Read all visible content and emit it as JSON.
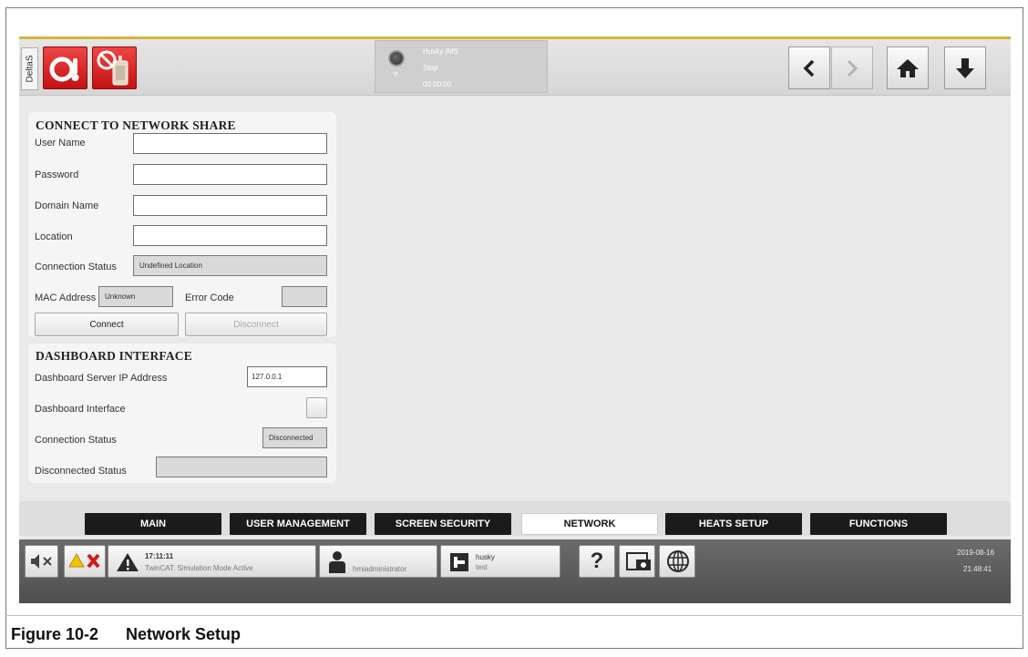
{
  "header": {
    "side_tab": "DeltaS",
    "status_name": "Husky IMS",
    "status_state": "Stop",
    "status_unit": "°F",
    "status_time": "00:00:00"
  },
  "network_share": {
    "title": "CONNECT TO NETWORK SHARE",
    "user_name_label": "User Name",
    "user_name_value": "",
    "password_label": "Password",
    "password_value": "",
    "domain_label": "Domain Name",
    "domain_value": "",
    "location_label": "Location",
    "location_value": "",
    "status_label": "Connection Status",
    "status_value": "Undefined Location",
    "mac_label": "MAC Address",
    "mac_value": "Unknown",
    "error_label": "Error Code",
    "error_value": "",
    "connect_label": "Connect",
    "disconnect_label": "Disconnect"
  },
  "dashboard": {
    "title": "DASHBOARD INTERFACE",
    "ip_label": "Dashboard Server IP Address",
    "ip_value": "127.0.0.1",
    "interface_label": "Dashboard Interface",
    "interface_checked": false,
    "conn_label": "Connection Status",
    "conn_value": "Disconnected",
    "disc_label": "Disconnected Status",
    "disc_value": ""
  },
  "tabs": [
    {
      "label": "MAIN"
    },
    {
      "label": "USER MANAGEMENT"
    },
    {
      "label": "SCREEN SECURITY"
    },
    {
      "label": "NETWORK",
      "active": true
    },
    {
      "label": "HEATS SETUP"
    },
    {
      "label": "FUNCTIONS"
    }
  ],
  "statusbar": {
    "alarm_time": "17:11:11",
    "alarm_message": "TwinCAT: Simulation Mode Active",
    "user": "hmiadministrator",
    "mold_name": "husky",
    "mold_sub": "test",
    "help": "?",
    "date": "2019-08-16",
    "time": "21:48:41"
  },
  "caption": {
    "number": "Figure 10-2",
    "title": "Network Setup"
  },
  "colors": {
    "accent": "#d8b43a",
    "red_button": "#dd2a2a",
    "tab_dark": "#1b1b1b",
    "tab_active": "#ffffff",
    "warning": "#f2c200",
    "error": "#d11a1a"
  }
}
